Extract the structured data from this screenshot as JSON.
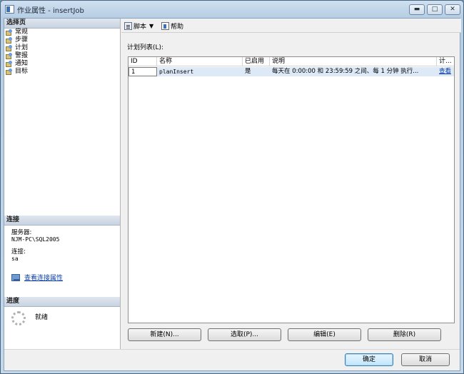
{
  "window": {
    "title": "作业属性 - insertJob",
    "minimize_glyph": "▬",
    "maximize_glyph": "□",
    "close_glyph": "✕"
  },
  "left_pane": {
    "select_page_header": "选择页",
    "pages": [
      {
        "label": "常规"
      },
      {
        "label": "步骤"
      },
      {
        "label": "计划"
      },
      {
        "label": "警报"
      },
      {
        "label": "通知"
      },
      {
        "label": "目标"
      }
    ],
    "connection_header": "连接",
    "server_label": "服务器:",
    "server_value": "NJM-PC\\SQL2005",
    "connection_label": "连接:",
    "connection_value": "sa",
    "view_connection_link": "查看连接属性",
    "progress_header": "进度",
    "progress_status": "就绪"
  },
  "toolbar": {
    "script_label": "脚本",
    "script_caret": "▼",
    "help_label": "帮助"
  },
  "schedule": {
    "list_label": "计划列表(L):",
    "columns": [
      "ID",
      "名称",
      "已启用",
      "说明",
      "计..."
    ],
    "rows": [
      {
        "id": "1",
        "name": "planInsert",
        "enabled": "是",
        "description": "每天在 0:00:00 和 23:59:59 之间、每 1 分钟 执行...",
        "action": "查看"
      }
    ]
  },
  "buttons": {
    "new": "新建(N)...",
    "pick": "选取(P)...",
    "edit": "编辑(E)",
    "delete": "删除(R)",
    "ok": "确定",
    "cancel": "取消"
  }
}
